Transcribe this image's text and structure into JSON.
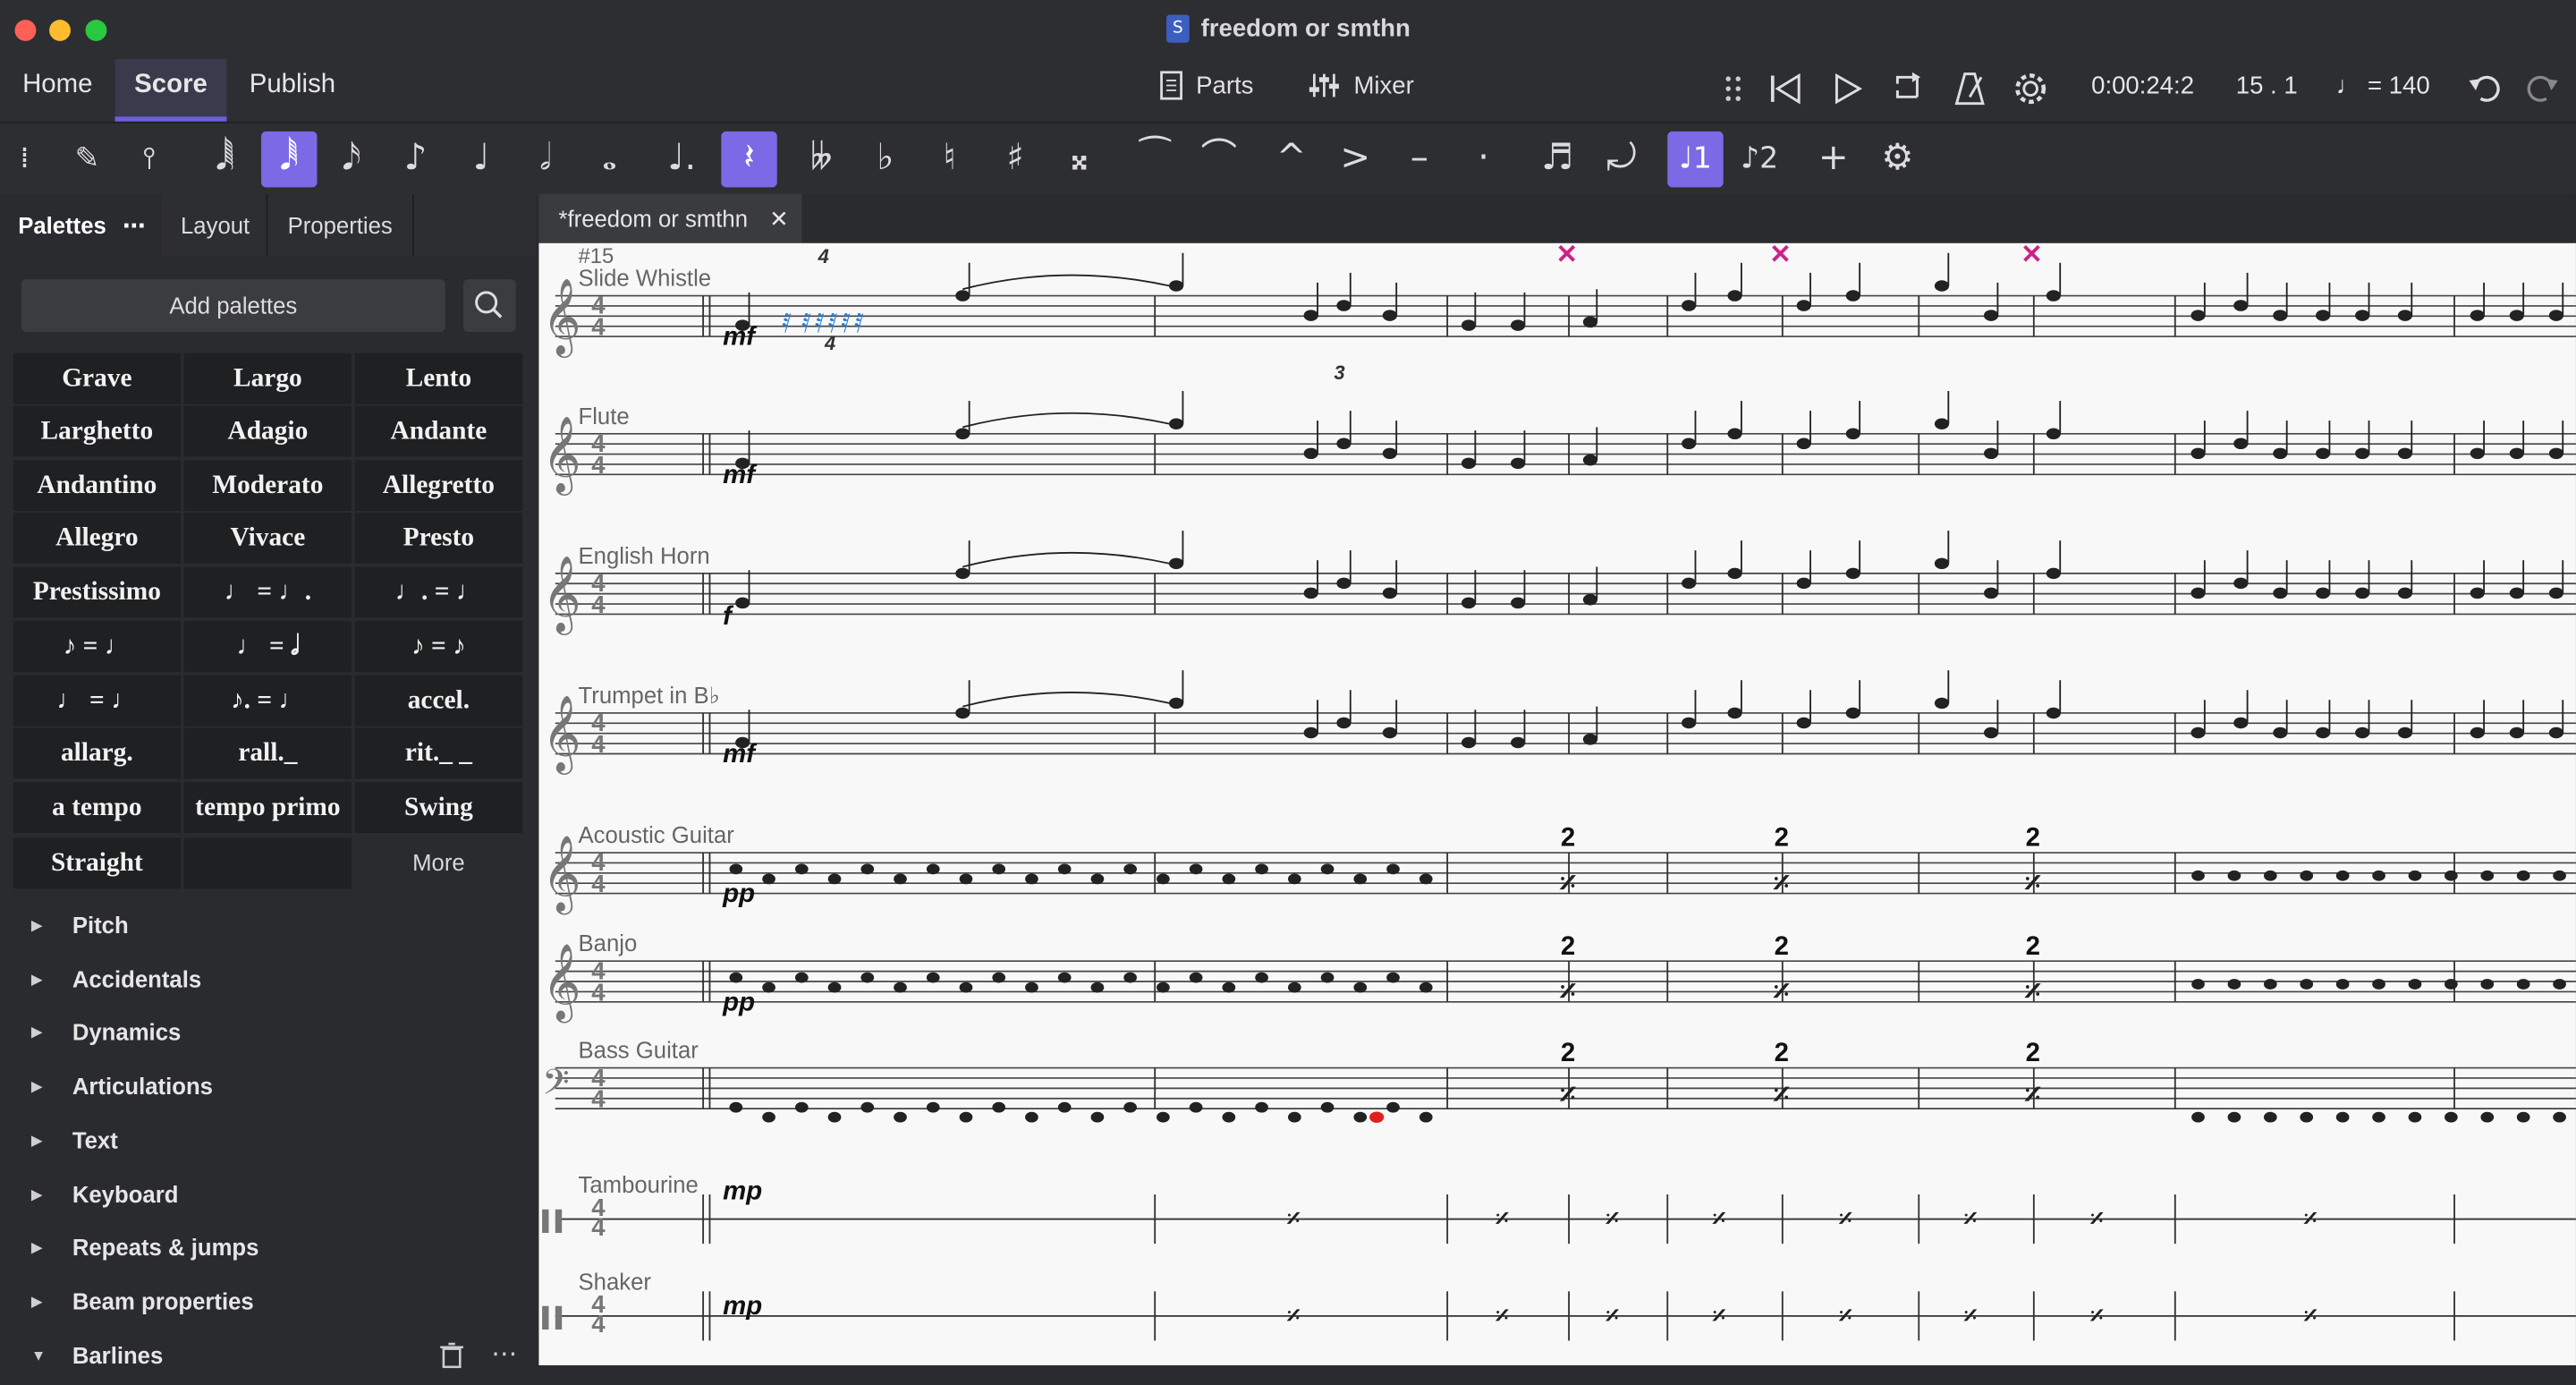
{
  "window": {
    "title": "freedom or smthn"
  },
  "menubar": {
    "tabs": [
      "Home",
      "Score",
      "Publish"
    ],
    "parts_label": "Parts",
    "mixer_label": "Mixer",
    "time": "0:00:24:2",
    "position": "15 . 1",
    "tempo": "♩ = 140"
  },
  "panel": {
    "tabs": [
      "Palettes",
      "Layout",
      "Properties"
    ],
    "add_palettes": "Add palettes",
    "tempo_items": [
      "Grave",
      "Largo",
      "Lento",
      "Larghetto",
      "Adagio",
      "Andante",
      "Andantino",
      "Moderato",
      "Allegretto",
      "Allegro",
      "Vivace",
      "Presto",
      "Prestissimo",
      "♩ = ♩.",
      "♩. = ♩",
      "♪ = ♩",
      "♩ = 𝅗𝅥",
      "♪ = ♪",
      "♩ = ♩",
      "♪. = ♩",
      "accel.",
      "allarg.",
      "rall._",
      "rit._ _",
      "a tempo",
      "tempo primo",
      "Swing",
      "Straight",
      "",
      "More"
    ],
    "sections": [
      "Pitch",
      "Accidentals",
      "Dynamics",
      "Articulations",
      "Text",
      "Keyboard",
      "Repeats & jumps",
      "Beam properties",
      "Barlines"
    ]
  },
  "score": {
    "tab_label": "*freedom or smthn",
    "measure_number": "#15",
    "instruments": [
      "Slide Whistle",
      "Flute",
      "English Horn",
      "Trumpet in B♭",
      "Acoustic Guitar",
      "Banjo",
      "Bass Guitar",
      "Tambourine",
      "Shaker"
    ],
    "dynamics": [
      "mf",
      "mf",
      "f",
      "mf",
      "pp",
      "pp",
      "mp",
      "mp"
    ],
    "tuplet_labels": [
      "4",
      "4",
      "3"
    ],
    "repeat_count": "2",
    "time_signature": "4"
  },
  "colors": {
    "accent": "#7a6ae6",
    "selection": "#2a7fd4",
    "error": "#e02020",
    "marker": "#cc2288"
  }
}
